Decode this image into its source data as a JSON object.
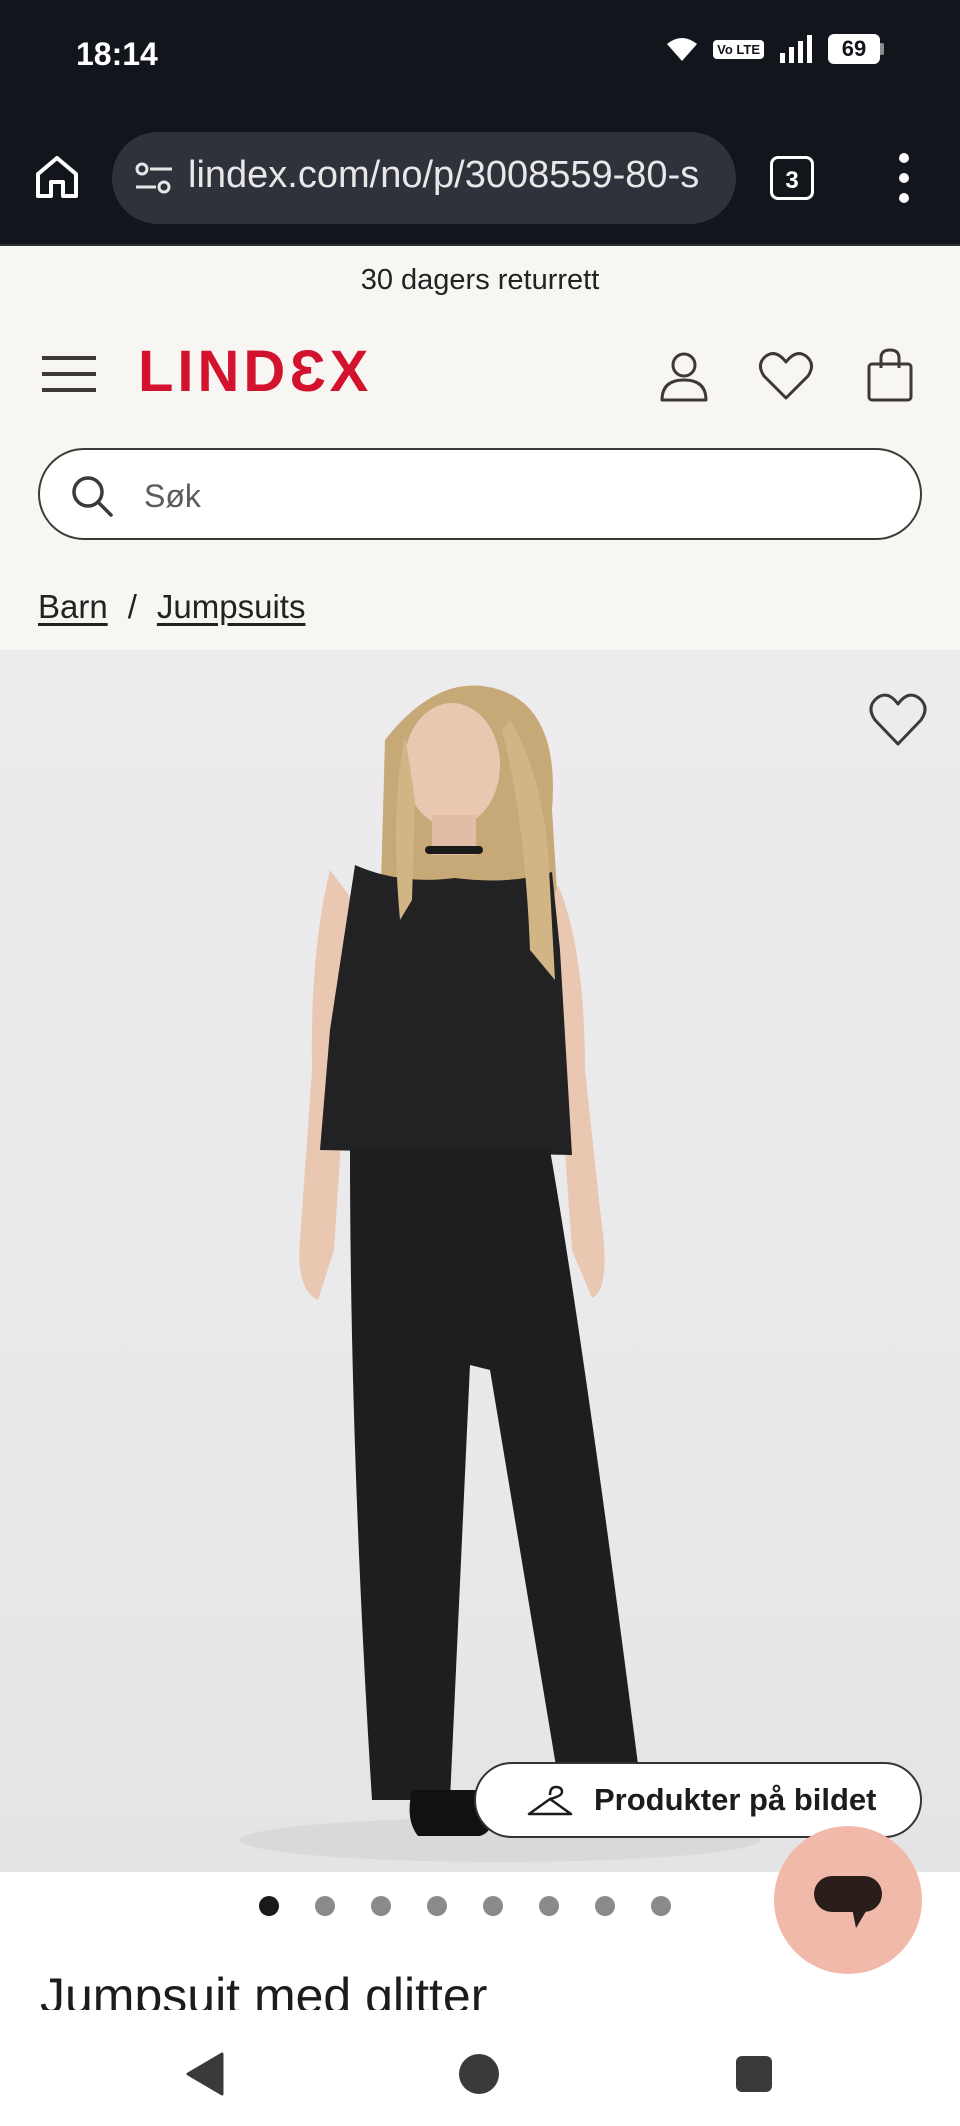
{
  "status_bar": {
    "time": "18:14",
    "volte": "Vo LTE",
    "battery": "69"
  },
  "browser": {
    "url": "lindex.com/no/p/3008559-80-s",
    "tab_count": "3"
  },
  "site": {
    "promo": "30 dagers returrett",
    "logo": "LINDƐX",
    "brand_color": "#d3122e",
    "search": {
      "placeholder": "Søk"
    },
    "breadcrumb": [
      {
        "label": "Barn"
      },
      {
        "label": "Jumpsuits"
      }
    ],
    "breadcrumb_separator": "/"
  },
  "product": {
    "shop_look_label": "Produkter på bildet",
    "carousel": {
      "total": 8,
      "active": 1
    },
    "title": "Jumpsuit med glitter"
  },
  "icons": {
    "home": "home-icon",
    "url_settings": "tune-icon",
    "menu": "more-vert-icon",
    "hamburger": "hamburger-icon",
    "account": "user-icon",
    "wishlist": "heart-icon",
    "bag": "shopping-bag-icon",
    "search": "search-icon",
    "hanger": "hanger-icon",
    "chat": "chat-icon"
  }
}
